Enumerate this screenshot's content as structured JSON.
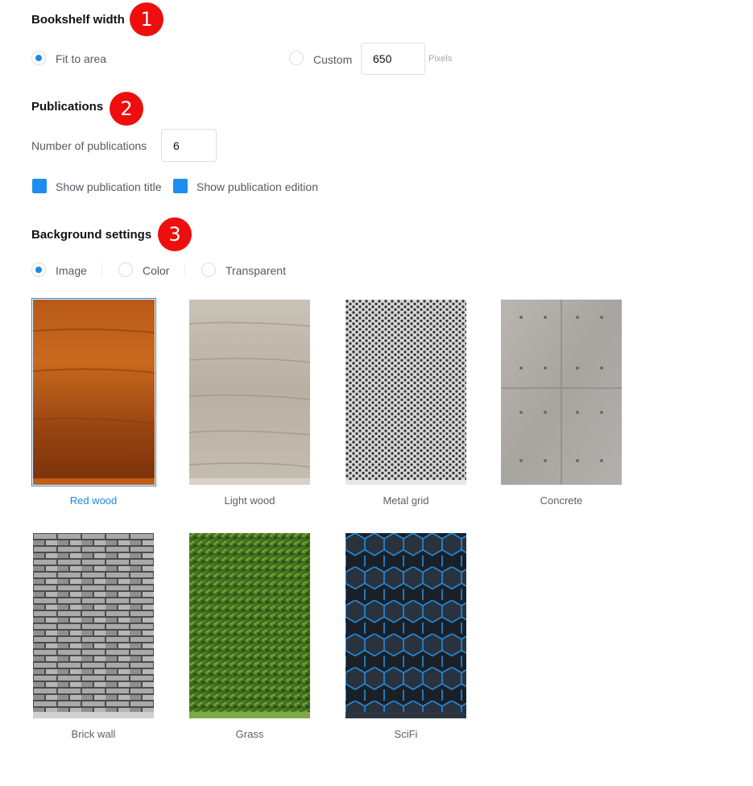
{
  "bookshelf_width": {
    "heading": "Bookshelf width",
    "step": "1",
    "options": [
      {
        "label": "Fit to area",
        "selected": true
      },
      {
        "label": "Custom",
        "selected": false
      }
    ],
    "custom_value": "650",
    "unit": "Pixels"
  },
  "publications": {
    "heading": "Publications",
    "step": "2",
    "count_label": "Number of publications",
    "count_value": "6",
    "checkboxes": [
      {
        "label": "Show publication title",
        "checked": true
      },
      {
        "label": "Show publication edition",
        "checked": true
      }
    ]
  },
  "background": {
    "heading": "Background settings",
    "step": "3",
    "modes": [
      {
        "label": "Image",
        "selected": true
      },
      {
        "label": "Color",
        "selected": false
      },
      {
        "label": "Transparent",
        "selected": false
      }
    ],
    "selected_texture": "Red wood",
    "textures": [
      {
        "label": "Red wood"
      },
      {
        "label": "Light wood"
      },
      {
        "label": "Metal grid"
      },
      {
        "label": "Concrete"
      },
      {
        "label": "Brick wall"
      },
      {
        "label": "Grass"
      },
      {
        "label": "SciFi"
      }
    ]
  },
  "colors": {
    "accent": "#1e88e5",
    "badge": "#ee0e0e",
    "checkbox": "#1e8cf0"
  }
}
